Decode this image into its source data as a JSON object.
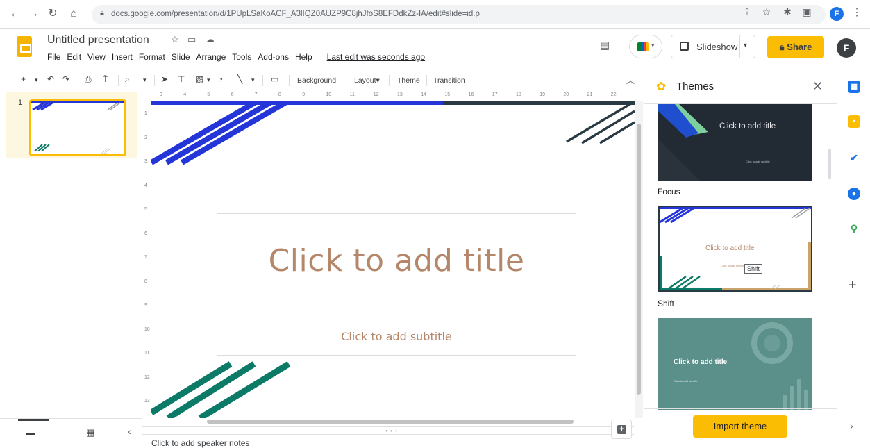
{
  "browser": {
    "url": "docs.google.com/presentation/d/1PUpLSaKoACF_A3lIQZ0AUZP9C8jhJfoS8EFDdkZz-IA/edit#slide=id.p",
    "profile_initial": "F"
  },
  "app": {
    "doc_title": "Untitled presentation",
    "menu": [
      "File",
      "Edit",
      "View",
      "Insert",
      "Format",
      "Slide",
      "Arrange",
      "Tools",
      "Add-ons",
      "Help"
    ],
    "last_edit": "Last edit was seconds ago",
    "slideshow_label": "Slideshow",
    "share_label": "Share",
    "avatar_initial": "F"
  },
  "toolbar": {
    "background_label": "Background",
    "layout_label": "Layout",
    "theme_label": "Theme",
    "transition_label": "Transition"
  },
  "filmstrip": {
    "slide_number": "1"
  },
  "ruler": {
    "h_ticks": [
      "3",
      "4",
      "5",
      "6",
      "7",
      "8",
      "9",
      "10",
      "11",
      "12",
      "13",
      "14",
      "15",
      "16",
      "17",
      "18",
      "19",
      "20",
      "21",
      "22"
    ],
    "v_ticks": [
      "1",
      "2",
      "3",
      "4",
      "5",
      "6",
      "7",
      "8",
      "9",
      "10",
      "11",
      "12",
      "13"
    ]
  },
  "slide": {
    "title_placeholder": "Click to add title",
    "subtitle_placeholder": "Click to add subtitle",
    "speaker_notes": "Click to add speaker notes"
  },
  "themes": {
    "panel_title": "Themes",
    "items": [
      {
        "name": "Focus",
        "title_text": "Click to add title",
        "subtitle_text": "Click to add subtitle"
      },
      {
        "name": "Shift",
        "title_text": "Click to add title",
        "subtitle_text": "Click to add subtitle",
        "tooltip": "Shift"
      },
      {
        "name": "",
        "title_text": "Click to add title",
        "subtitle_text": "Click to add subtitle"
      }
    ],
    "import_label": "Import theme"
  },
  "colors": {
    "accent_yellow": "#fbbc04",
    "slide_blue": "#2536d9",
    "slide_green": "#0b7a66",
    "slide_dark": "#2a3a45",
    "title_brown": "#b5876a"
  }
}
